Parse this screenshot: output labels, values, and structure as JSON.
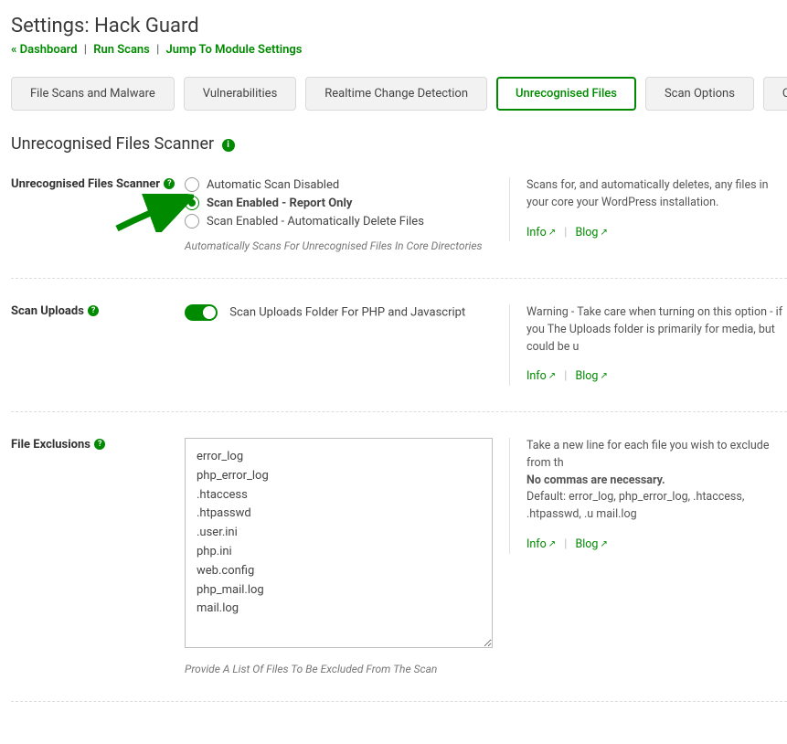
{
  "header": {
    "title": "Settings: Hack Guard",
    "breadcrumb": {
      "dashboard": "« Dashboard",
      "run_scans": "Run Scans",
      "jump": "Jump To Module Settings"
    }
  },
  "tabs": [
    {
      "label": "File Scans and Malware",
      "active": false
    },
    {
      "label": "Vulnerabilities",
      "active": false
    },
    {
      "label": "Realtime Change Detection",
      "active": false
    },
    {
      "label": "Unrecognised Files",
      "active": true
    },
    {
      "label": "Scan Options",
      "active": false
    },
    {
      "label": "On/Off",
      "active": false
    }
  ],
  "section": {
    "title": "Unrecognised Files Scanner"
  },
  "rows": {
    "scanner": {
      "label": "Unrecognised Files Scanner",
      "options": [
        {
          "label": "Automatic Scan Disabled",
          "selected": false
        },
        {
          "label": "Scan Enabled - Report Only",
          "selected": true
        },
        {
          "label": "Scan Enabled - Automatically Delete Files",
          "selected": false
        }
      ],
      "hint": "Automatically Scans For Unrecognised Files In Core Directories",
      "desc": "Scans for, and automatically deletes, any files in your core your WordPress installation.",
      "info_label": "Info",
      "blog_label": "Blog"
    },
    "uploads": {
      "label": "Scan Uploads",
      "toggle_on": true,
      "toggle_label": "Scan Uploads Folder For PHP and Javascript",
      "desc": "Warning - Take care when turning on this option - if you The Uploads folder is primarily for media, but could be u",
      "info_label": "Info",
      "blog_label": "Blog"
    },
    "exclusions": {
      "label": "File Exclusions",
      "value": "error_log\nphp_error_log\n.htaccess\n.htpasswd\n.user.ini\nphp.ini\nweb.config\nphp_mail.log\nmail.log",
      "hint": "Provide A List Of Files To Be Excluded From The Scan",
      "desc_line1": "Take a new line for each file you wish to exclude from th",
      "desc_strong": "No commas are necessary.",
      "desc_line2": "Default: error_log, php_error_log, .htaccess, .htpasswd, .u mail.log",
      "info_label": "Info",
      "blog_label": "Blog"
    }
  }
}
